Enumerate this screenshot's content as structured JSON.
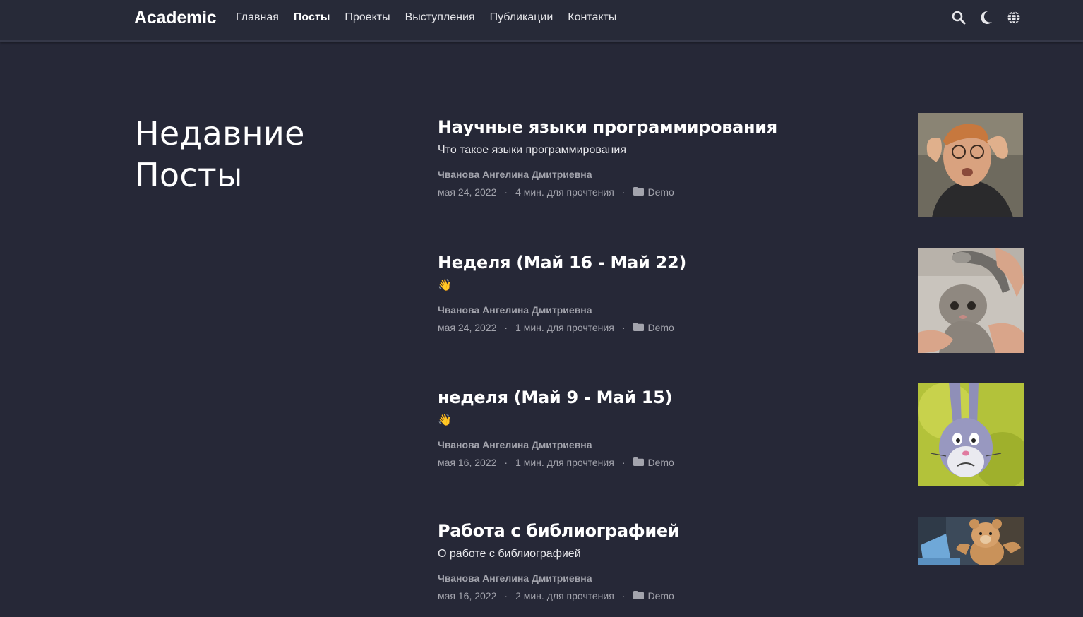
{
  "navbar": {
    "brand": "Academic",
    "links": [
      {
        "label": "Главная",
        "active": false
      },
      {
        "label": "Посты",
        "active": true
      },
      {
        "label": "Проекты",
        "active": false
      },
      {
        "label": "Выступления",
        "active": false
      },
      {
        "label": "Публикации",
        "active": false
      },
      {
        "label": "Контакты",
        "active": false
      }
    ],
    "icons": [
      "search-icon",
      "moon-icon",
      "globe-icon"
    ]
  },
  "section": {
    "title_line1": "Недавние",
    "title_line2": "Посты"
  },
  "posts": [
    {
      "title": "Научные языки программирования",
      "summary": "Что такое языки программирования",
      "author": "Чванова Ангелина Дмитриевна",
      "date": "мая 24, 2022",
      "reading_time": "4 мин. для прочтения",
      "separator": "·",
      "category": "Demo",
      "thumbnail": "man-mind-blown-image"
    },
    {
      "title": "Неделя (Май 16 - Май 22)",
      "summary": "👋",
      "author": "Чванова Ангелина Дмитриевна",
      "date": "мая 24, 2022",
      "reading_time": "1 мин. для прочтения",
      "separator": "·",
      "category": "Demo",
      "thumbnail": "wet-cat-shower-image"
    },
    {
      "title": "неделя (Май 9 - Май 15)",
      "summary": "👋",
      "author": "Чванова Ангелина Дмитриевна",
      "date": "мая 16, 2022",
      "reading_time": "1 мин. для прочтения",
      "separator": "·",
      "category": "Demo",
      "thumbnail": "cartoon-rabbit-image"
    },
    {
      "title": "Работа с библиографией",
      "summary": "О работе с библиографией",
      "author": "Чванова Ангелина Дмитриевна",
      "date": "мая 16, 2022",
      "reading_time": "2 мин. для прочтения",
      "separator": "·",
      "category": "Demo",
      "thumbnail": "teddy-bear-laptop-image"
    }
  ],
  "colors": {
    "background": "#262837",
    "navbar": "#272a38",
    "meta_text": "#a3a4ad"
  }
}
